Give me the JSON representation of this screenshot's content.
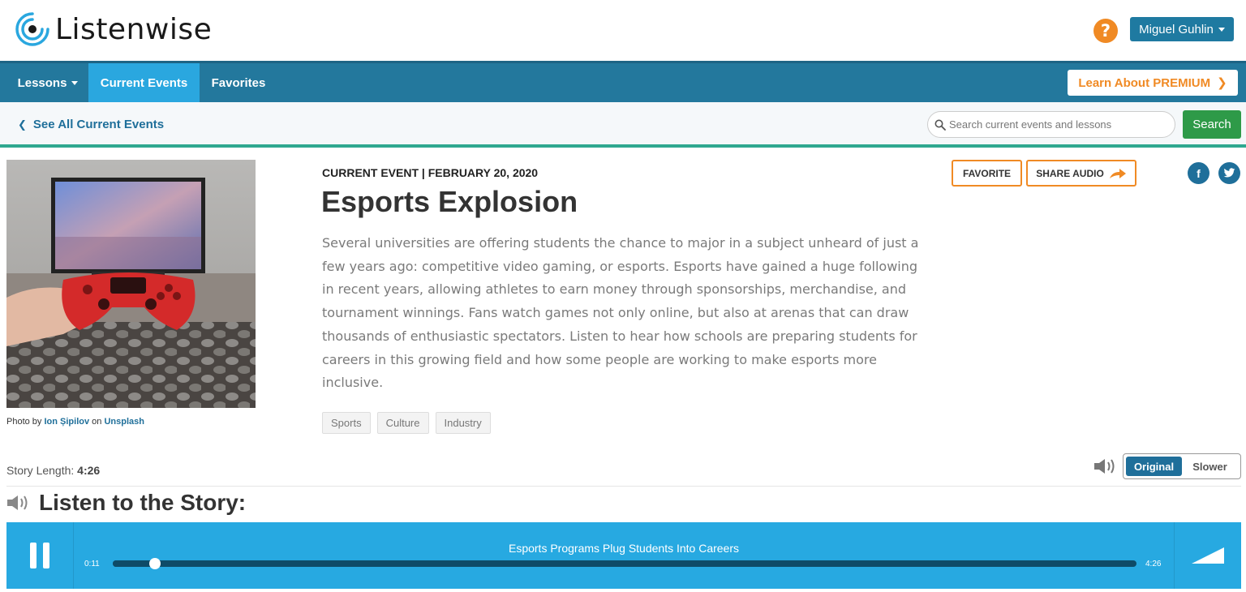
{
  "app": {
    "logo_text": "Listenwise"
  },
  "header": {
    "help_label": "?",
    "user_name": "Miguel Guhlin"
  },
  "nav": {
    "items": [
      {
        "label": "Lessons",
        "dropdown": true
      },
      {
        "label": "Current Events",
        "active": true
      },
      {
        "label": "Favorites"
      }
    ],
    "premium_label": "Learn About PREMIUM"
  },
  "subbar": {
    "back_label": "See All Current Events",
    "search_placeholder": "Search current events and lessons",
    "search_value": "",
    "search_button": "Search"
  },
  "story": {
    "photo_credit": {
      "prefix": "Photo by",
      "author": "Ion Șipilov",
      "joiner": "on",
      "source": "Unsplash"
    },
    "eyebrow": "CURRENT EVENT | FEBRUARY 20, 2020",
    "title": "Esports Explosion",
    "description": "Several universities are offering students the chance to major in a subject unheard of just a few years ago: competitive video gaming, or esports. Esports have gained a huge following in recent years, allowing athletes to earn money through sponsorships, merchandise, and tournament winnings. Fans watch games not only online, but also at arenas that can draw thousands of enthusiastic spectators. Listen to hear how schools are preparing students for careers in this growing field and how some people are working to make esports more inclusive.",
    "tags": [
      "Sports",
      "Culture",
      "Industry"
    ],
    "favorite_label": "FAVORITE",
    "share_label": "SHARE AUDIO",
    "social": {
      "facebook": "f",
      "twitter": "t"
    },
    "length_label": "Story Length:",
    "length_value": "4:26",
    "speed": {
      "options": [
        "Original",
        "Slower"
      ],
      "selected": "Original"
    },
    "listen_heading": "Listen to the Story:"
  },
  "player": {
    "track_title": "Esports Programs Plug Students Into Careers",
    "current_time": "0:11",
    "total_time": "4:26",
    "progress_fraction": 0.041,
    "state": "playing"
  },
  "colors": {
    "nav": "#23789d",
    "nav_active": "#2aa7df",
    "accent_orange": "#f08a24",
    "search_green": "#2e9a48",
    "player": "#27a9e1"
  }
}
